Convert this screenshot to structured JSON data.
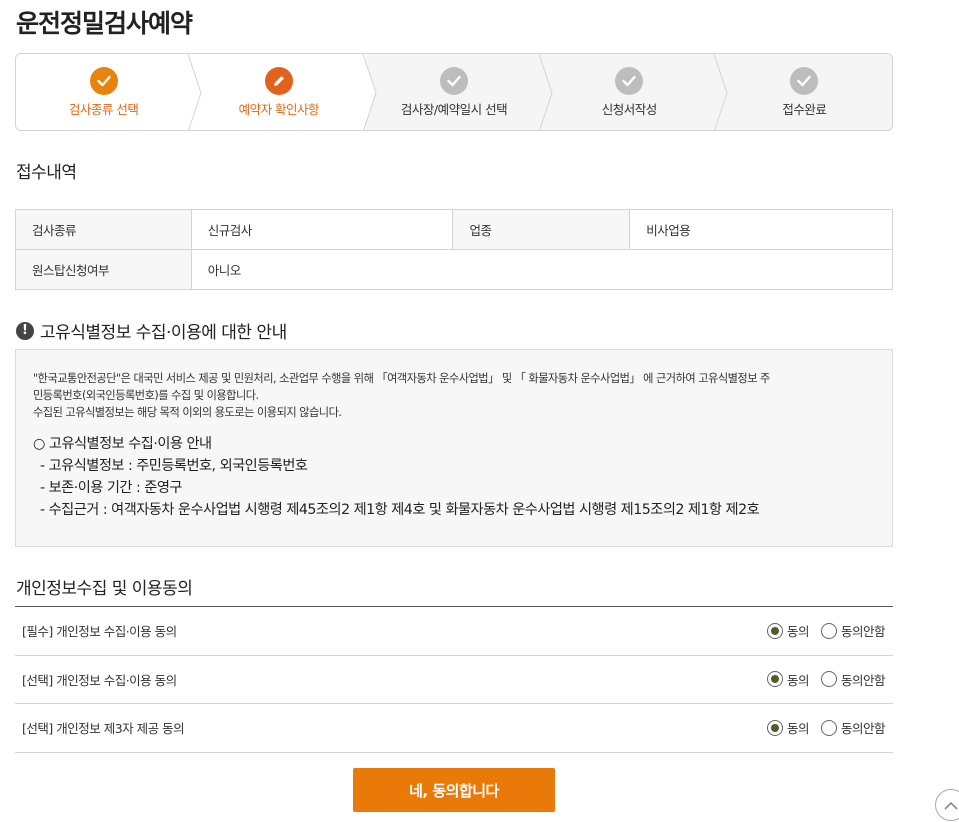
{
  "page": {
    "title": "운전정밀검사예약"
  },
  "stepper": {
    "steps": [
      {
        "label": "검사종류 선택",
        "state": "done",
        "icon": "check-icon"
      },
      {
        "label": "예약자 확인사항",
        "state": "current",
        "icon": "pencil-icon"
      },
      {
        "label": "검사장/예약일시 선택",
        "state": "todo",
        "icon": "check-icon"
      },
      {
        "label": "신청서작성",
        "state": "todo",
        "icon": "check-icon"
      },
      {
        "label": "접수완료",
        "state": "todo",
        "icon": "check-icon"
      }
    ]
  },
  "receipt": {
    "title": "접수내역",
    "rows": [
      [
        {
          "h": "검사종류",
          "v": "신규검사"
        },
        {
          "h": "업종",
          "v": "비사업용"
        }
      ],
      [
        {
          "h": "원스탑신청여부",
          "v": "아니오"
        }
      ]
    ]
  },
  "notice": {
    "title": "고유식별정보 수집·이용에 대한 안내",
    "icon": "exclamation-icon",
    "paragraph1": "\"한국교통안전공단\"은 대국민 서비스 제공 및 민원처리, 소관업무 수행을 위해 「여객자동차 운수사업법」 및 「 화물자동차 운수사업법」 에 근거하여 고유식별정보 주",
    "paragraph2": "민등록번호(외국인등록번호)를 수집 및 이용합니다.",
    "paragraph3": "수집된 고유식별정보는 해당 목적 이외의 용도로는 이용되지 않습니다.",
    "items": [
      "○ 고유식별정보 수집·이용 안내",
      "- 고유식별정보 : 주민등록번호, 외국인등록번호",
      "- 보존·이용 기간 : 준영구",
      "- 수집근거 : 여객자동차 운수사업법 시행령 제45조의2 제1항 제4호 및 화물자동차 운수사업법 시행령 제15조의2 제1항 제2호"
    ]
  },
  "consent": {
    "title": "개인정보수집 및 이용동의",
    "agree_label": "동의",
    "disagree_label": "동의안함",
    "rows": [
      {
        "label": "[필수] 개인정보 수집·이용 동의",
        "selected": "agree"
      },
      {
        "label": "[선택] 개인정보 수집·이용 동의",
        "selected": "agree"
      },
      {
        "label": "[선택] 개인정보 제3자 제공 동의",
        "selected": "agree"
      }
    ]
  },
  "actions": {
    "agree_button": "네, 동의합니다"
  },
  "colors": {
    "accent": "#e97a0a",
    "step_current": "#e2611b",
    "radio_selected": "#4a6024"
  }
}
